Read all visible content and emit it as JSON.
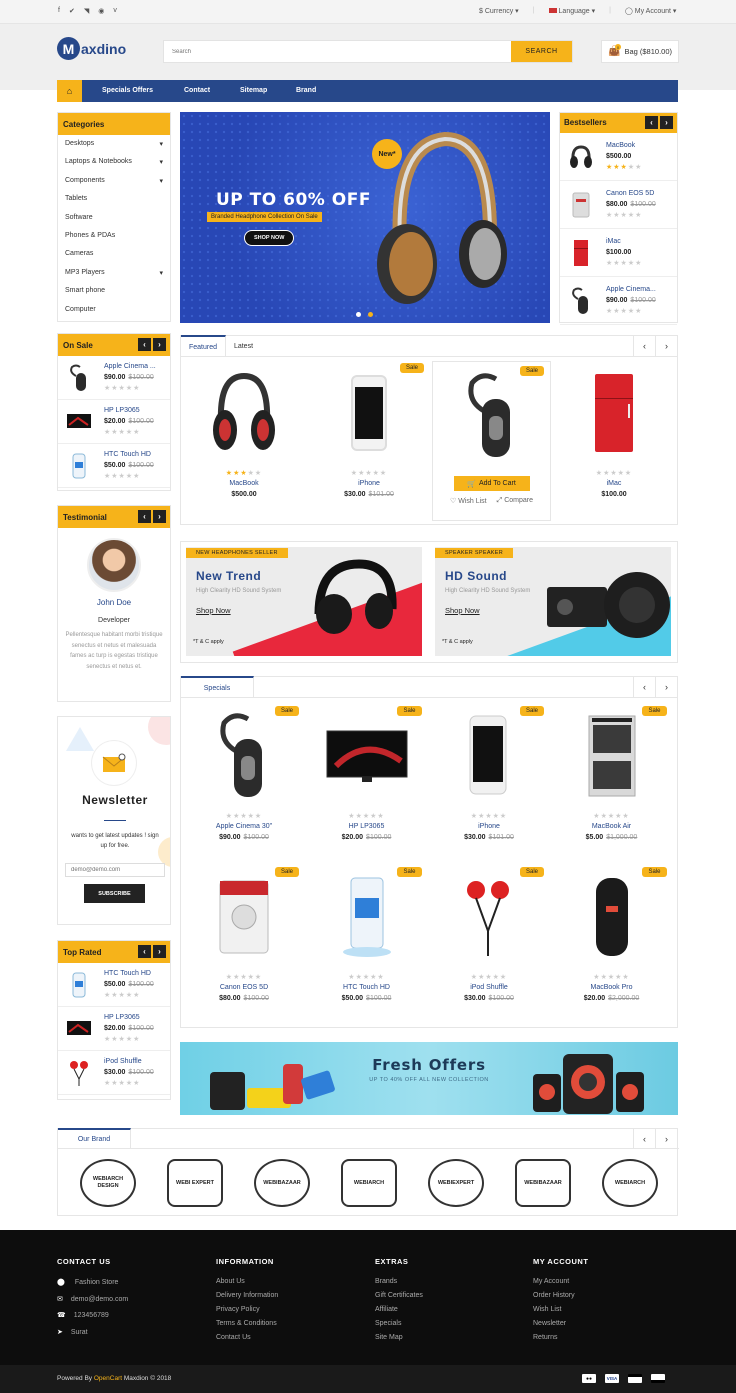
{
  "topbar": {
    "currency": "$ Currency",
    "language": "Language",
    "account": "My Account",
    "social": [
      "facebook-icon",
      "twitter-icon",
      "rss-icon",
      "pinterest-icon",
      "vimeo-icon"
    ]
  },
  "header": {
    "logo_letter": "M",
    "logo_text": "axdino",
    "search_placeholder": "Search",
    "search_button": "SEARCH",
    "cart_label": "Bag ($810.00)",
    "cart_count": "0"
  },
  "nav": {
    "items": [
      "Specials Offers",
      "Contact",
      "Sitemap",
      "Brand"
    ]
  },
  "categories": {
    "title": "Categories",
    "items": [
      {
        "label": "Desktops",
        "sub": true
      },
      {
        "label": "Laptops & Notebooks",
        "sub": true
      },
      {
        "label": "Components",
        "sub": true
      },
      {
        "label": "Tablets",
        "sub": false
      },
      {
        "label": "Software",
        "sub": false
      },
      {
        "label": "Phones & PDAs",
        "sub": false
      },
      {
        "label": "Cameras",
        "sub": false
      },
      {
        "label": "MP3 Players",
        "sub": true
      },
      {
        "label": "Smart phone",
        "sub": false
      },
      {
        "label": "Computer",
        "sub": false
      }
    ]
  },
  "hero": {
    "badge": "New*",
    "headline": "UP TO 60% OFF",
    "tagline": "Branded Headphone Collection On Sale",
    "button": "SHOP NOW"
  },
  "bestsellers": {
    "title": "Bestsellers",
    "items": [
      {
        "name": "MacBook",
        "price": "$500.00",
        "old": "",
        "rating": 3
      },
      {
        "name": "Canon EOS 5D",
        "price": "$80.00",
        "old": "$100.00",
        "rating": 0
      },
      {
        "name": "iMac",
        "price": "$100.00",
        "old": "",
        "rating": 0
      },
      {
        "name": "Apple Cinema...",
        "price": "$90.00",
        "old": "$100.00",
        "rating": 0
      }
    ]
  },
  "onsale": {
    "title": "On Sale",
    "items": [
      {
        "name": "Apple Cinema ...",
        "price": "$90.00",
        "old": "$100.00"
      },
      {
        "name": "HP LP3065",
        "price": "$20.00",
        "old": "$100.00"
      },
      {
        "name": "HTC Touch HD",
        "price": "$50.00",
        "old": "$100.00"
      }
    ]
  },
  "featured": {
    "tabs": [
      "Featured",
      "Latest"
    ],
    "products": [
      {
        "name": "MacBook",
        "price": "$500.00",
        "old": "",
        "sale": "",
        "rating": 3
      },
      {
        "name": "iPhone",
        "price": "$30.00",
        "old": "$101.00",
        "sale": "Sale",
        "rating": 0
      },
      {
        "name": "",
        "price": "",
        "old": "",
        "sale": "Sale",
        "rating": 0,
        "add": "Add To Cart",
        "wish": "Wish List",
        "compare": "Compare"
      },
      {
        "name": "iMac",
        "price": "$100.00",
        "old": "",
        "sale": "",
        "rating": 0
      }
    ]
  },
  "testimonial": {
    "title": "Testimonial",
    "name": "John Doe",
    "role": "Developer",
    "text": "Pellentesque habitant morbi tristique senectus et netus et malesuada fames ac turp is egestas tristique senectus et netus et."
  },
  "banners": [
    {
      "tag": "NEW HEADPHONES SELLER",
      "title1": "New",
      "title2": "Trend",
      "sub": "High Clearity HD Sound System",
      "link": "Shop Now",
      "note": "*T & C apply"
    },
    {
      "tag": "SPEAKER SPEAKER",
      "title1": "HD",
      "title2": "Sound",
      "sub": "High Clearity HD Sound System",
      "link": "Shop Now",
      "note": "*T & C apply"
    }
  ],
  "newsletter": {
    "title": "Newsletter",
    "text": "wants to get latest updates ! sign up for free.",
    "placeholder": "demo@demo.com",
    "button": "SUBSCRIBE"
  },
  "specials": {
    "tab": "Specials",
    "products": [
      {
        "name": "Apple Cinema 30\"",
        "price": "$90.00",
        "old": "$100.00"
      },
      {
        "name": "HP LP3065",
        "price": "$20.00",
        "old": "$100.00"
      },
      {
        "name": "iPhone",
        "price": "$30.00",
        "old": "$101.00"
      },
      {
        "name": "MacBook Air",
        "price": "$5.00",
        "old": "$1,000.00"
      },
      {
        "name": "Canon EOS 5D",
        "price": "$80.00",
        "old": "$100.00"
      },
      {
        "name": "HTC Touch HD",
        "price": "$50.00",
        "old": "$100.00"
      },
      {
        "name": "iPod Shuffle",
        "price": "$30.00",
        "old": "$100.00"
      },
      {
        "name": "MacBook Pro",
        "price": "$20.00",
        "old": "$2,000.00"
      }
    ],
    "sale": "Sale"
  },
  "toprated": {
    "title": "Top Rated",
    "items": [
      {
        "name": "HTC Touch HD",
        "price": "$50.00",
        "old": "$100.00"
      },
      {
        "name": "HP LP3065",
        "price": "$20.00",
        "old": "$100.00"
      },
      {
        "name": "iPod Shuffle",
        "price": "$30.00",
        "old": "$100.00"
      }
    ]
  },
  "fresh": {
    "title": "Fresh Offers",
    "sub": "UP TO 40% OFF ALL NEW COLLECTION"
  },
  "brands": {
    "title": "Our Brand",
    "logos": [
      "WEBIARCH DESIGN",
      "WEBI EXPERT",
      "WEBIBAZAAR",
      "WEBIARCH",
      "WEBIEXPERT",
      "WEBIBAZAAR",
      "WEBIARCH"
    ]
  },
  "footer": {
    "contact": {
      "title": "CONTACT US",
      "store": "Fashion Store",
      "email": "demo@demo.com",
      "phone": "123456789",
      "city": "Surat"
    },
    "information": {
      "title": "INFORMATION",
      "links": [
        "About Us",
        "Delivery Information",
        "Privacy Policy",
        "Terms & Conditions",
        "Contact Us"
      ]
    },
    "extras": {
      "title": "EXTRAS",
      "links": [
        "Brands",
        "Gift Certificates",
        "Affiliate",
        "Specials",
        "Site Map"
      ]
    },
    "account": {
      "title": "MY ACCOUNT",
      "links": [
        "My Account",
        "Order History",
        "Wish List",
        "Newsletter",
        "Returns"
      ]
    },
    "powered_prefix": "Powered By ",
    "powered_link": "OpenCart",
    "powered_suffix": " Maxdion © 2018",
    "payments": [
      "mastercard-icon",
      "visa-icon",
      "credit-card-icon",
      "card-icon"
    ]
  },
  "colors": {
    "accent": "#f6b31a",
    "navy": "#27488a",
    "footer": "#0d0d0d"
  }
}
